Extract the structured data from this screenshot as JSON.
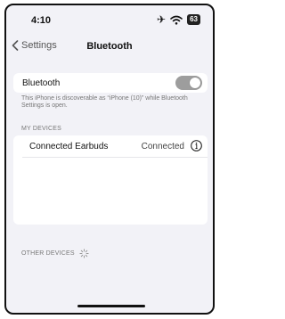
{
  "status_bar": {
    "time": "4:10",
    "airplane_icon": "airplane-icon",
    "wifi_icon": "wifi-icon",
    "battery_level": "63"
  },
  "nav": {
    "back_label": "Settings",
    "title": "Bluetooth"
  },
  "bluetooth": {
    "label": "Bluetooth",
    "toggle_on": false,
    "discoverable_text": "This iPhone is discoverable as “iPhone (10)” while Bluetooth Settings is open."
  },
  "my_devices": {
    "header": "MY DEVICES",
    "items": [
      {
        "name": "Connected Earbuds",
        "status": "Connected"
      }
    ]
  },
  "other_devices": {
    "header": "OTHER DEVICES"
  },
  "colors": {
    "background": "#f2f2f7",
    "toggle_off": "#9d9d9d"
  }
}
